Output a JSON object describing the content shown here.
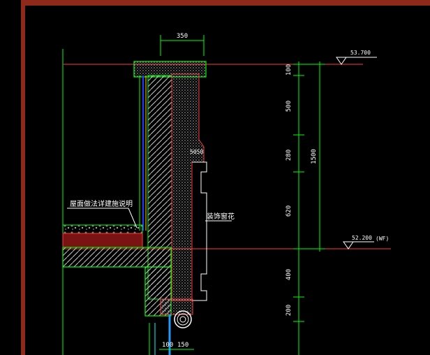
{
  "drawing": {
    "top_dimension": "350",
    "elevations": {
      "top": "53.700",
      "floor": "52.200",
      "floor_tag": "(WF)"
    },
    "vertical_dims": [
      "100",
      "500",
      "280",
      "620",
      "400",
      "200"
    ],
    "total_dim": "1500",
    "small_dim": "5050",
    "bottom_dims": [
      "100",
      "150"
    ],
    "labels": {
      "roof_note": "屋面做法详建施说明",
      "decor_note": "装饰窗花"
    }
  },
  "colors": {
    "frame": "#8f2a1a",
    "dimension": "#00ff00",
    "level": "#ff3b3b",
    "concrete": "#9aa7a5",
    "text": "#ffffff",
    "insulation": "#1f3cff"
  }
}
